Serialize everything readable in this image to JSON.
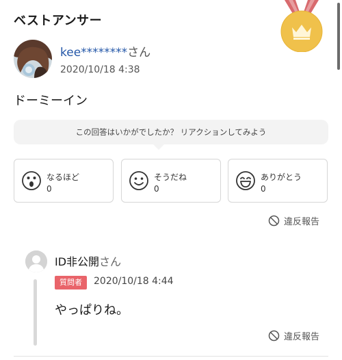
{
  "section_title": "ベストアンサー",
  "answer": {
    "user_name": "kee********",
    "honorific": "さん",
    "date": "2020/10/18 4:38",
    "body": "ドーミーイン"
  },
  "reaction_prompt": "この回答はいかがでしたか？ リアクションしてみよう",
  "reactions": [
    {
      "label": "なるほど",
      "count": "0",
      "icon": "surprised-face-icon"
    },
    {
      "label": "そうだね",
      "count": "0",
      "icon": "smile-face-icon"
    },
    {
      "label": "ありがとう",
      "count": "0",
      "icon": "grin-face-icon"
    }
  ],
  "report_label": "違反報告",
  "reply": {
    "user_name": "ID非公開",
    "honorific": "さん",
    "badge": "質問者",
    "date": "2020/10/18 4:44",
    "body": "やっぱりね。"
  },
  "colors": {
    "link_blue": "#2457a8",
    "badge_red": "#e9646a",
    "medal_gold": "#f0c14b",
    "ribbon_red": "#d86a6e"
  }
}
